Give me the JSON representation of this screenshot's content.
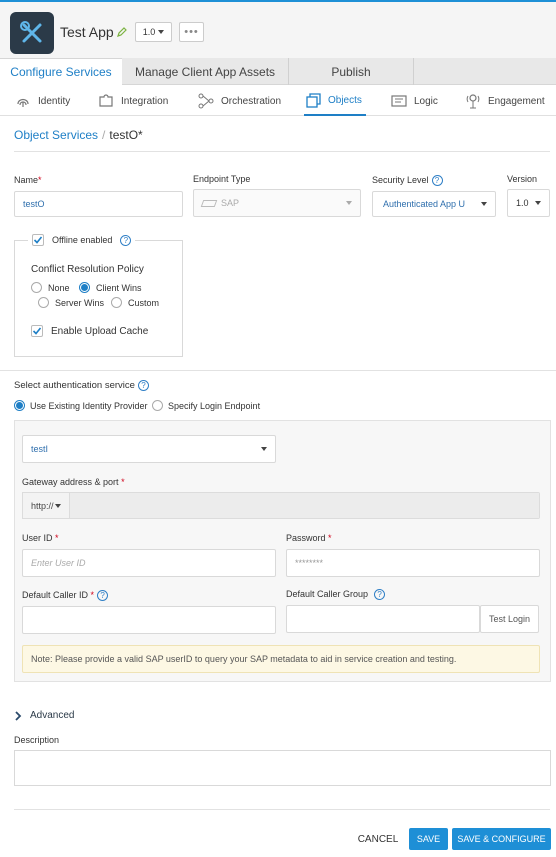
{
  "header": {
    "app_title": "Test App",
    "version": "1.0",
    "more": "•••"
  },
  "top_tabs": [
    {
      "label": "Configure Services"
    },
    {
      "label": "Manage Client App Assets"
    },
    {
      "label": "Publish"
    }
  ],
  "sub_tabs": [
    {
      "label": "Identity",
      "icon": "fingerprint-icon"
    },
    {
      "label": "Integration",
      "icon": "puzzle-icon"
    },
    {
      "label": "Orchestration",
      "icon": "flow-icon"
    },
    {
      "label": "Objects",
      "icon": "objects-icon"
    },
    {
      "label": "Logic",
      "icon": "logic-icon"
    },
    {
      "label": "Engagement",
      "icon": "engagement-icon"
    }
  ],
  "breadcrumb": {
    "parent": "Object Services",
    "separator": "/",
    "current": "testO*"
  },
  "form": {
    "name_label": "Name",
    "name_required": "*",
    "name_value": "testO",
    "endpoint_label": "Endpoint Type",
    "endpoint_value": "SAP",
    "security_label": "Security Level",
    "security_value": "Authenticated App U",
    "version_label": "Version",
    "version_value": "1.0"
  },
  "offline": {
    "label": "Offline enabled",
    "conflict_label": "Conflict Resolution Policy",
    "options": [
      {
        "label": "None",
        "selected": false
      },
      {
        "label": "Client Wins",
        "selected": true
      },
      {
        "label": "Server Wins",
        "selected": false
      },
      {
        "label": "Custom",
        "selected": false
      }
    ],
    "upload_cache_label": "Enable Upload Cache"
  },
  "auth": {
    "label": "Select authentication service",
    "option_existing": "Use Existing Identity Provider",
    "option_login": "Specify Login Endpoint",
    "provider_value": "testI",
    "gateway_label": "Gateway address & port",
    "gateway_protocol": "http://",
    "userid_label": "User ID",
    "userid_placeholder": "Enter User ID",
    "password_label": "Password",
    "password_value": "********",
    "caller_id_label": "Default Caller ID",
    "caller_group_label": "Default Caller Group",
    "test_login": "Test Login",
    "note": "Note: Please provide a valid SAP userID to query your SAP metadata to aid in service creation and testing."
  },
  "advanced_label": "Advanced",
  "description_label": "Description",
  "footer": {
    "cancel": "CANCEL",
    "save": "SAVE",
    "save_configure": "SAVE & CONFIGURE"
  },
  "colors": {
    "accent": "#1e8fd6",
    "app_icon_bg": "#2b3a48",
    "note_bg": "#fdf8e4"
  }
}
